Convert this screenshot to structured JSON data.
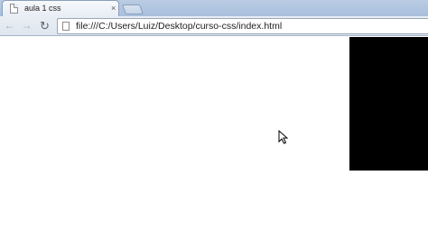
{
  "browser": {
    "tab": {
      "title": "aula 1 css",
      "close_glyph": "×",
      "icon": "document-icon"
    },
    "toolbar": {
      "back_glyph": "←",
      "forward_glyph": "→",
      "reload_glyph": "↻"
    },
    "address_bar": {
      "url": "file:///C:/Users/Luiz/Desktop/curso-css/index.html",
      "icon": "page-icon"
    }
  },
  "page": {
    "background_color": "#ffffff",
    "box_color": "#000000"
  },
  "colors": {
    "tabstrip": "#b9cce3",
    "toolbar": "#e9eef5"
  }
}
